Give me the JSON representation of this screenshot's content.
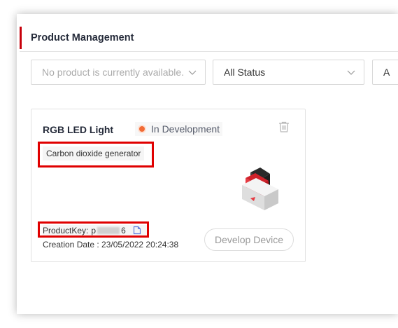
{
  "header": {
    "title": "Product Management"
  },
  "filters": {
    "product_placeholder": "No product is currently available.",
    "status_value": "All Status",
    "third_value": "A"
  },
  "card": {
    "name": "RGB LED Light",
    "status": "In Development",
    "description": "Carbon dioxide generator",
    "product_key_label": "ProductKey:",
    "product_key_visible_start": "p",
    "product_key_visible_end": "6",
    "creation_date": "Creation Date : 23/05/2022 20:24:38",
    "develop_button": "Develop Device"
  },
  "colors": {
    "accent": "#c7000b",
    "status_dot": "#f26b35",
    "highlight": "#e00000"
  }
}
